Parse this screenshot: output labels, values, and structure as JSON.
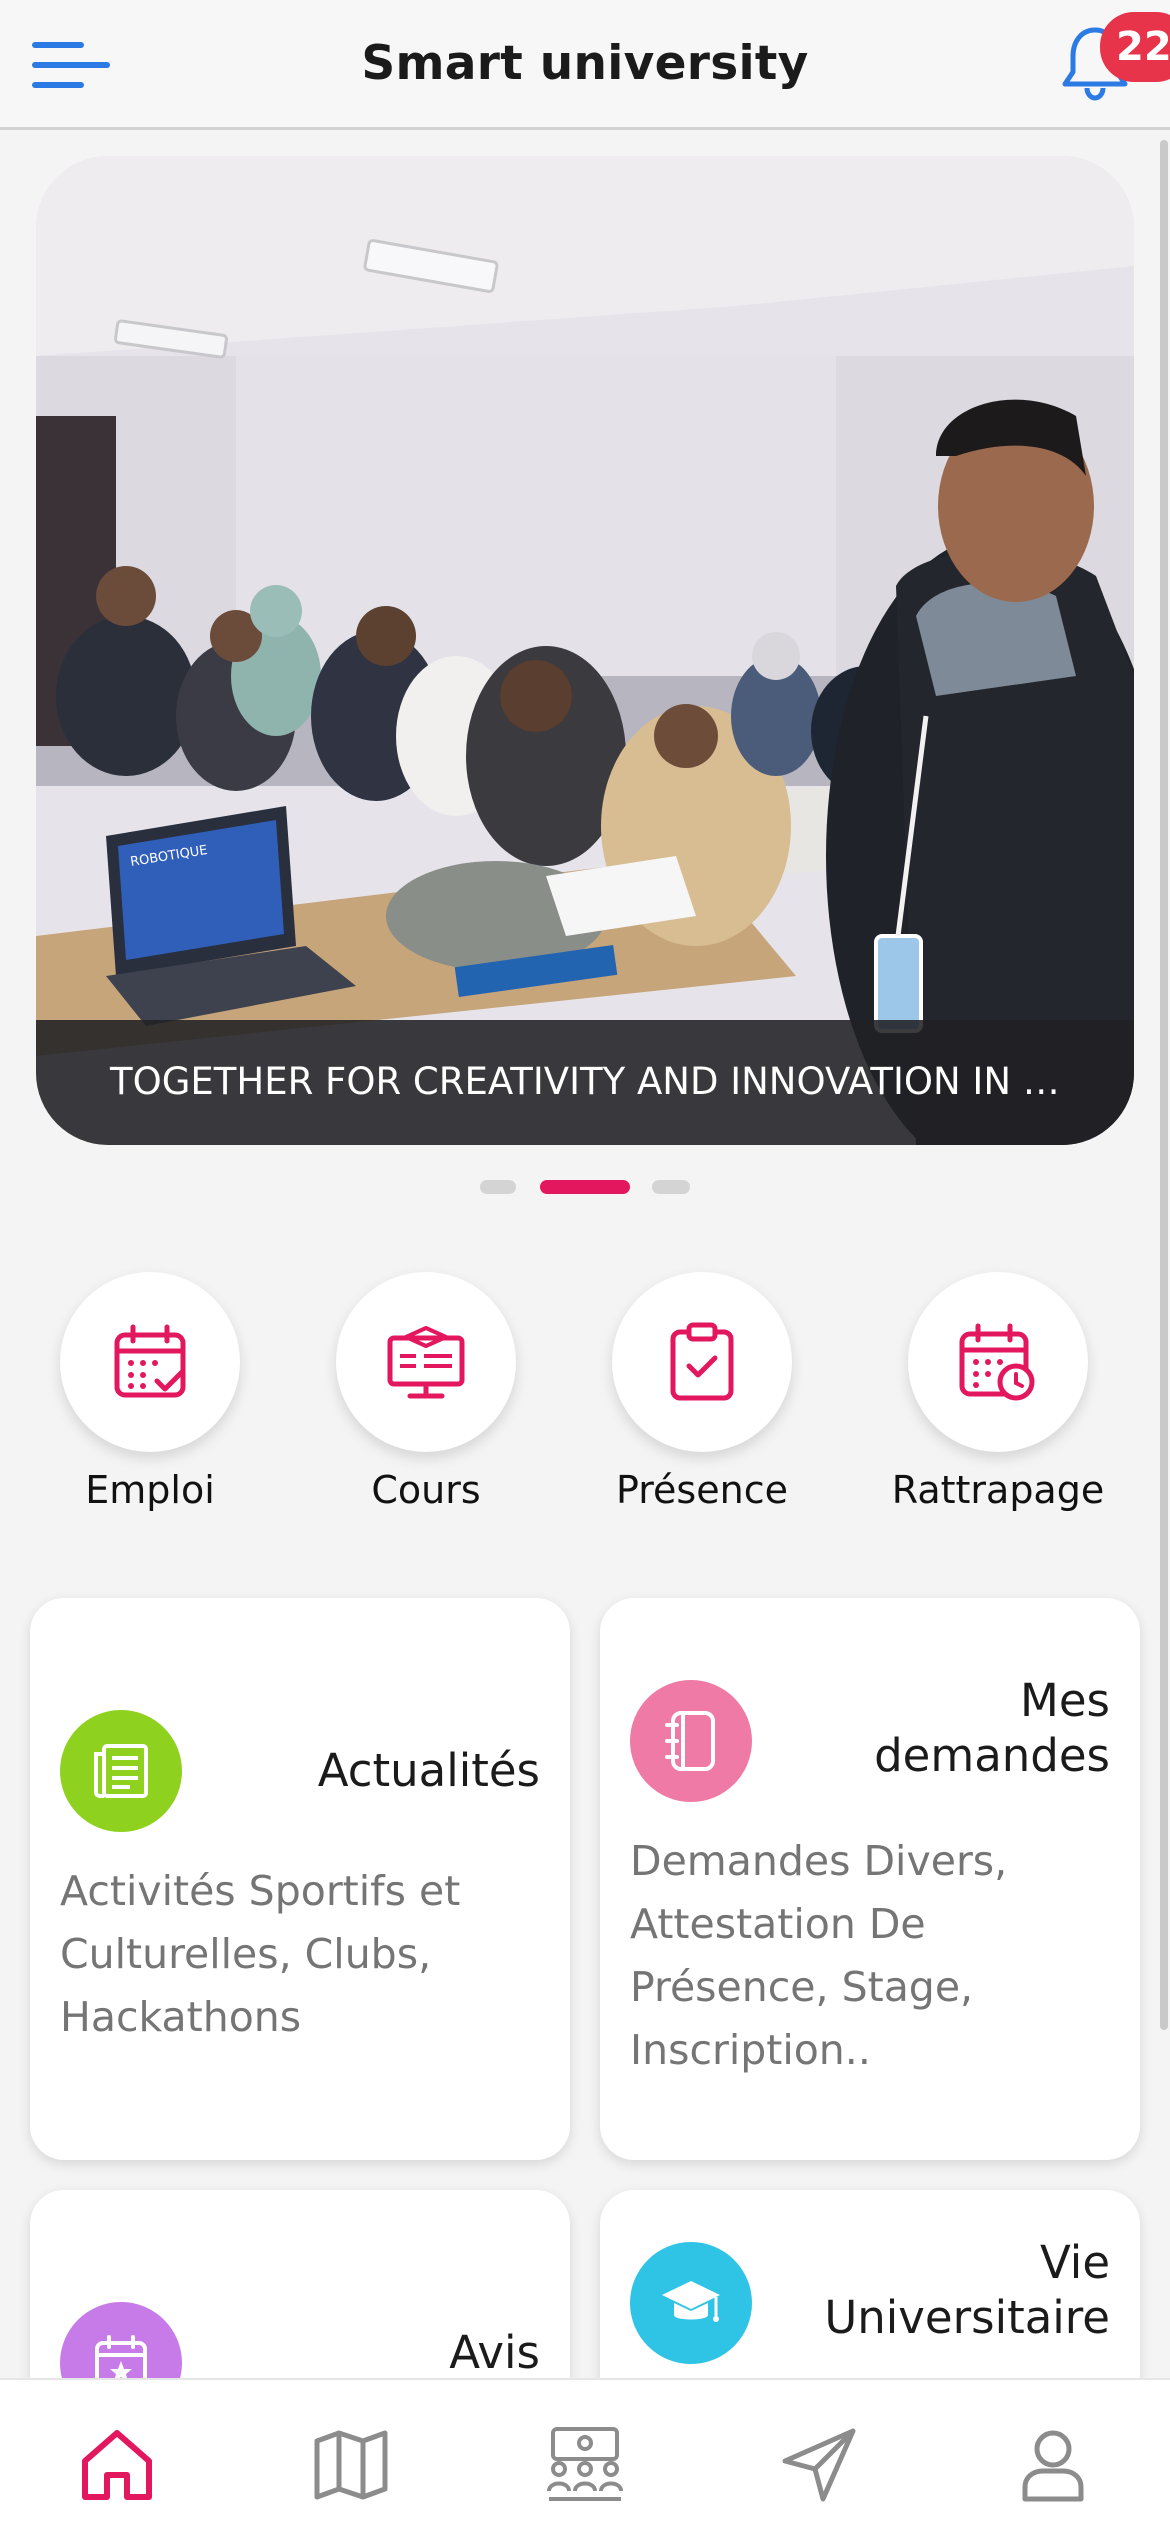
{
  "header": {
    "title": "Smart university",
    "notification_count": "22"
  },
  "banner": {
    "caption": "TOGETHER FOR CREATIVITY AND INNOVATION IN THE...",
    "slides": 3,
    "active_slide": 2,
    "laptop_text": "ROBOTIQUE"
  },
  "quick_actions": [
    {
      "label": "Emploi",
      "icon": "calendar-check-icon"
    },
    {
      "label": "Cours",
      "icon": "course-board-icon"
    },
    {
      "label": "Présence",
      "icon": "clipboard-check-icon"
    },
    {
      "label": "Rattrapage",
      "icon": "calendar-clock-icon"
    }
  ],
  "cards": {
    "actualites": {
      "title": "Actualités",
      "desc": "Activités Sportifs et Culturelles, Clubs, Hackathons",
      "icon": "news-icon",
      "color": "#8fd11f"
    },
    "demandes": {
      "title_line1": "Mes",
      "title_line2": "demandes",
      "desc": "Demandes Divers, Attestation De Présence, Stage, Inscription..",
      "icon": "notebook-icon",
      "color": "#f07aa6"
    },
    "avis": {
      "title": "Avis",
      "icon": "calendar-star-icon",
      "color": "#c77be8"
    },
    "vie": {
      "title_line1": "Vie",
      "title_line2": "Universitaire",
      "icon": "graduation-cap-icon",
      "color": "#2fc4e6"
    }
  },
  "bottom_nav": [
    {
      "name": "home",
      "icon": "home-icon",
      "active": true
    },
    {
      "name": "map",
      "icon": "map-icon",
      "active": false
    },
    {
      "name": "community",
      "icon": "group-meeting-icon",
      "active": false
    },
    {
      "name": "send",
      "icon": "send-icon",
      "active": false
    },
    {
      "name": "profile",
      "icon": "user-icon",
      "active": false
    }
  ],
  "colors": {
    "accent": "#e3175d",
    "menu": "#2c7be5",
    "badge": "#e8344b",
    "inactive_icon": "#8c8c8c"
  }
}
